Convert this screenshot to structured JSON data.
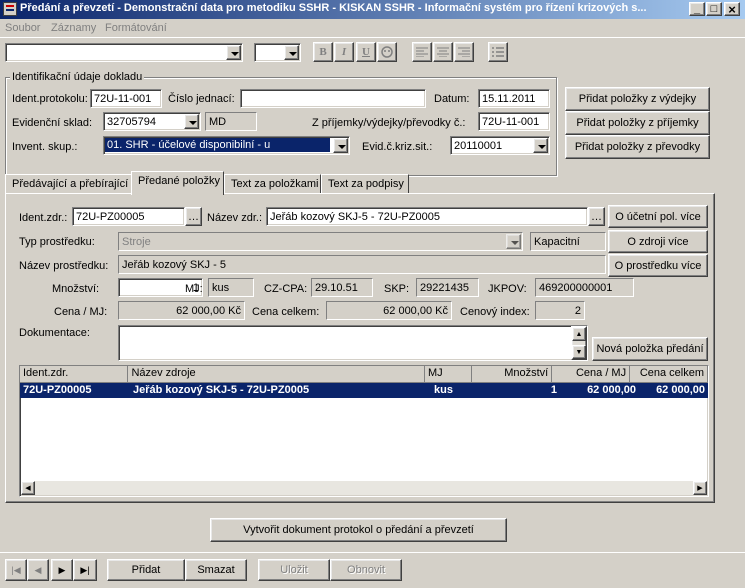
{
  "window": {
    "title": "Předání a převzetí - Demonstrační data pro metodiku SSHR - KISKAN SSHR - Informační systém pro řízení krizových s...",
    "minimize_glyph": "_",
    "maximize_glyph": "□",
    "close_glyph": "×"
  },
  "menu": [
    "Soubor",
    "Záznamy",
    "Formátování"
  ],
  "format_toolbar": {
    "bold": "B",
    "italic": "I",
    "underline": "U"
  },
  "header_group": {
    "legend": "Identifikační údaje dokladu",
    "ident_protokolu_label": "Ident.protokolu:",
    "ident_protokolu_value": "72U-11-001",
    "cislo_jednaci_label": "Číslo jednací:",
    "cislo_jednaci_value": "",
    "datum_label": "Datum:",
    "datum_value": "15.11.2011",
    "sklad_label": "Evidenční sklad:",
    "sklad_value": "32705794",
    "sklad_code": "MD",
    "zprijemky_label": "Z příjemky/výdejky/převodky č.:",
    "zprijemky_value": "72U-11-001",
    "invent_label": "Invent. skup.:",
    "invent_value": "01. SHR - účelové disponibilní - u",
    "evid_label": "Evid.č.kriz.sit.:",
    "evid_value": "20110001"
  },
  "side_buttons": [
    "Přidat položky z výdejky",
    "Přidat položky z příjemky",
    "Přidat položky z převodky"
  ],
  "tabs": [
    "Předávající a přebírající",
    "Předané položky",
    "Text za položkami",
    "Text za podpisy"
  ],
  "form": {
    "ident_zdr_label": "Ident.zdr.:",
    "ident_zdr_value": "72U-PZ00005",
    "nazev_zdr_label": "Název zdr.:",
    "nazev_zdr_value": "Jeřáb kozový SKJ-5 - 72U-PZ0005",
    "ucetni_btn": "O účetní pol. více",
    "typ_label": "Typ prostředku:",
    "typ_value": "Stroje",
    "kapacitni": "Kapacitní",
    "zdroji_btn": "O zdroji více",
    "nazev_prostredku_label": "Název prostředku:",
    "nazev_prostredku_value": "Jeřáb kozový  SKJ - 5",
    "prostredku_btn": "O prostředku více",
    "mnozstvi_label": "Množství:",
    "mnozstvi_value": "1",
    "mj_label": "MJ:",
    "mj_value": "kus",
    "czcpa_label": "CZ-CPA:",
    "czcpa_value": "29.10.51",
    "skp_label": "SKP:",
    "skp_value": "29221435",
    "jkpov_label": "JKPOV:",
    "jkpov_value": "469200000001",
    "cena_mj_label": "Cena / MJ:",
    "cena_mj_value": "62 000,00 Kč",
    "cena_celkem_label": "Cena celkem:",
    "cena_celkem_value": "62 000,00 Kč",
    "cenovy_index_label": "Cenový index:",
    "cenovy_index_value": "2",
    "dokumentace_label": "Dokumentace:",
    "dokumentace_value": "",
    "nova_polozka_btn": "Nová položka předání"
  },
  "grid": {
    "columns": [
      "Ident.zdr.",
      "Název zdroje",
      "MJ",
      "Množství",
      "Cena / MJ",
      "Cena celkem"
    ],
    "rows": [
      [
        "72U-PZ00005",
        "Jeřáb kozový SKJ-5 - 72U-PZ0005",
        "kus",
        "1",
        "62 000,00",
        "62 000,00"
      ]
    ]
  },
  "create_button": "Vytvořit dokument protokol o předání a převzetí",
  "bottom": {
    "nav_first": "|◀",
    "nav_prev": "◀",
    "nav_next": "▶",
    "nav_last": "▶|",
    "pridat": "Přidat",
    "smazat": "Smazat",
    "ulozit": "Uložit",
    "obnovit": "Obnovit"
  },
  "colors": {
    "title_start": "#0a246a",
    "title_end": "#a6caf0",
    "selection": "#0a246a",
    "face": "#d4d0c8"
  }
}
